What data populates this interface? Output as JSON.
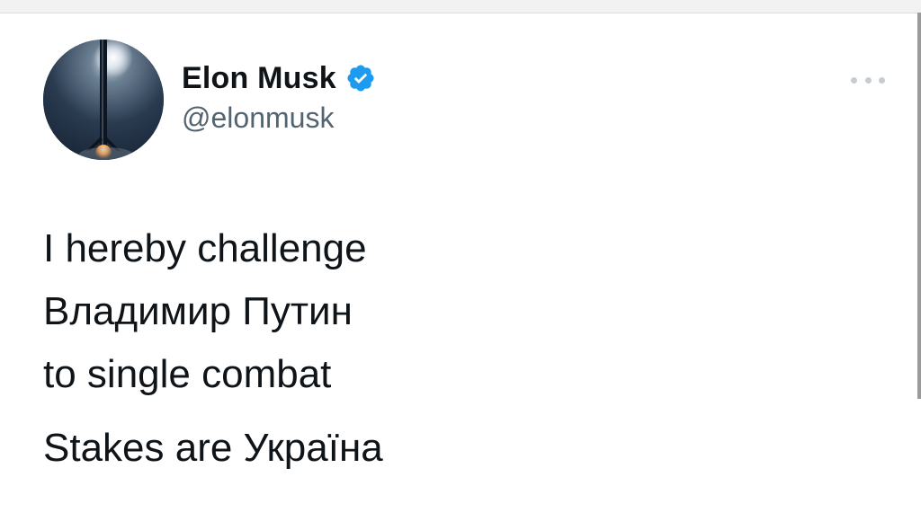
{
  "tweet": {
    "author": {
      "display_name": "Elon Musk",
      "handle": "@elonmusk",
      "verified": true,
      "avatar": "rocket-landing-avatar"
    },
    "text_lines": [
      "I hereby challenge",
      "Владимир Путин",
      "to single combat"
    ],
    "text_paragraph_2": "Stakes are Україна",
    "more_icon": "more-horizontal-icon"
  },
  "colors": {
    "text": "#0f1419",
    "secondary": "#536471",
    "verified": "#1d9bf0",
    "more_dots": "#c5ccd3"
  }
}
